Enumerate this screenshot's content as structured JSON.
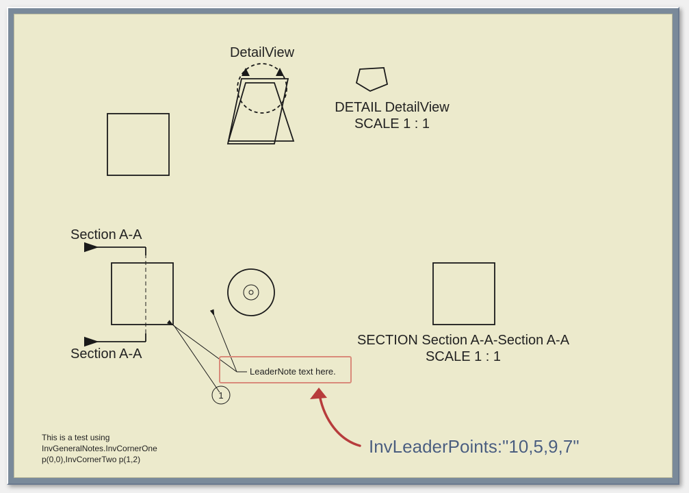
{
  "detailview": {
    "label_above": "DetailView",
    "label_line1": "DETAIL  DetailView",
    "label_line2": "SCALE 1 : 1"
  },
  "section": {
    "label_top": "Section A-A",
    "label_bottom": "Section A-A",
    "label_line1": "SECTION Section A-A-Section A-A",
    "label_line2": "SCALE 1 : 1"
  },
  "leadernote": {
    "text": "LeaderNote text here."
  },
  "balloon": {
    "number": "1"
  },
  "general_notes": {
    "line1": "This is a test using",
    "line2": "InvGeneralNotes.InvCornerOne",
    "line3": "p(0,0),InvCornerTwo p(1,2)"
  },
  "annotation": {
    "text": "InvLeaderPoints:\"10,5,9,7\""
  }
}
